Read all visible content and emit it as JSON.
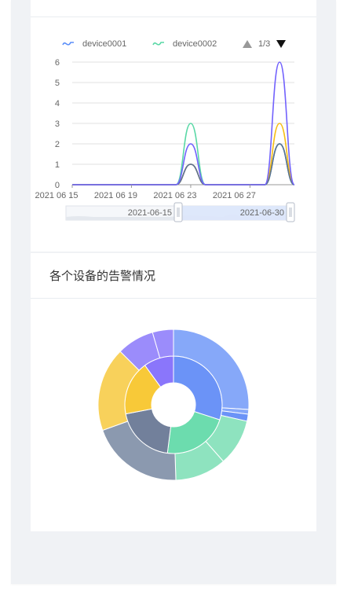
{
  "chart_data": [
    {
      "type": "line",
      "x": [
        "2021-06-15",
        "2021-06-16",
        "2021-06-17",
        "2021-06-18",
        "2021-06-19",
        "2021-06-20",
        "2021-06-21",
        "2021-06-22",
        "2021-06-23",
        "2021-06-24",
        "2021-06-25",
        "2021-06-26",
        "2021-06-27",
        "2021-06-28",
        "2021-06-29",
        "2021-06-30"
      ],
      "x_tick_labels": [
        "2021 06 15",
        "2021 06 19",
        "2021 06 23",
        "2021 06 27"
      ],
      "ylim": [
        0,
        6
      ],
      "y_ticks": [
        0,
        1,
        2,
        3,
        4,
        5,
        6
      ],
      "grid": true,
      "series": [
        {
          "name": "device0001",
          "color": "#5b8ff9",
          "values": [
            0,
            0,
            0,
            0,
            0,
            0,
            0,
            0,
            1,
            0,
            0,
            0,
            0,
            0,
            2,
            0
          ]
        },
        {
          "name": "device0002",
          "color": "#5ad8a6",
          "values": [
            0,
            0,
            0,
            0,
            0,
            0,
            0,
            0,
            3,
            0,
            0,
            0,
            0,
            0,
            2,
            0
          ]
        },
        {
          "name": "",
          "color": "#f6bd16",
          "values": [
            0,
            0,
            0,
            0,
            0,
            0,
            0,
            0,
            1,
            0,
            0,
            0,
            0,
            0,
            3,
            0
          ]
        },
        {
          "name": "",
          "color": "#5d7092",
          "values": [
            0,
            0,
            0,
            0,
            0,
            0,
            0,
            0,
            1,
            0,
            0,
            0,
            0,
            0,
            2,
            0
          ]
        },
        {
          "name": "",
          "color": "#7262fd",
          "values": [
            0,
            0,
            0,
            0,
            0,
            0,
            0,
            0,
            2,
            0,
            0,
            0,
            0,
            0,
            6,
            0
          ]
        }
      ],
      "legend_position": "top",
      "legend_page": "1/3",
      "data_zoom": {
        "start": "2021-06-15",
        "end": "2021-06-30"
      }
    },
    {
      "type": "pie",
      "title": "各个设备的告警情况",
      "inner_ring": [
        {
          "color": "#6b93f7",
          "value": 30
        },
        {
          "color": "#6cdcae",
          "value": 22
        },
        {
          "color": "#72809b",
          "value": 20
        },
        {
          "color": "#f8c938",
          "value": 18
        },
        {
          "color": "#8a76fb",
          "value": 10
        }
      ],
      "outer_ring": [
        {
          "color": "#86a8f9",
          "value": 26
        },
        {
          "color": "#86a8f9",
          "value": 1
        },
        {
          "color": "#6b93f7",
          "value": 1.5
        },
        {
          "color": "#8ee3bf",
          "value": 10
        },
        {
          "color": "#8ee3bf",
          "value": 11
        },
        {
          "color": "#8b99af",
          "value": 20
        },
        {
          "color": "#f8d15b",
          "value": 18
        },
        {
          "color": "#9b8cfb",
          "value": 8
        },
        {
          "color": "#9b8cfb",
          "value": 4.5
        }
      ]
    }
  ],
  "legend": {
    "items": [
      {
        "label": "device0001",
        "color": "#5b8ff9"
      },
      {
        "label": "device0002",
        "color": "#5ad8a6"
      }
    ],
    "page_text": "1/3"
  },
  "pie_title": "各个设备的告警情况",
  "zoom": {
    "start_label": "2021-06-15",
    "end_label": "2021-06-30"
  }
}
